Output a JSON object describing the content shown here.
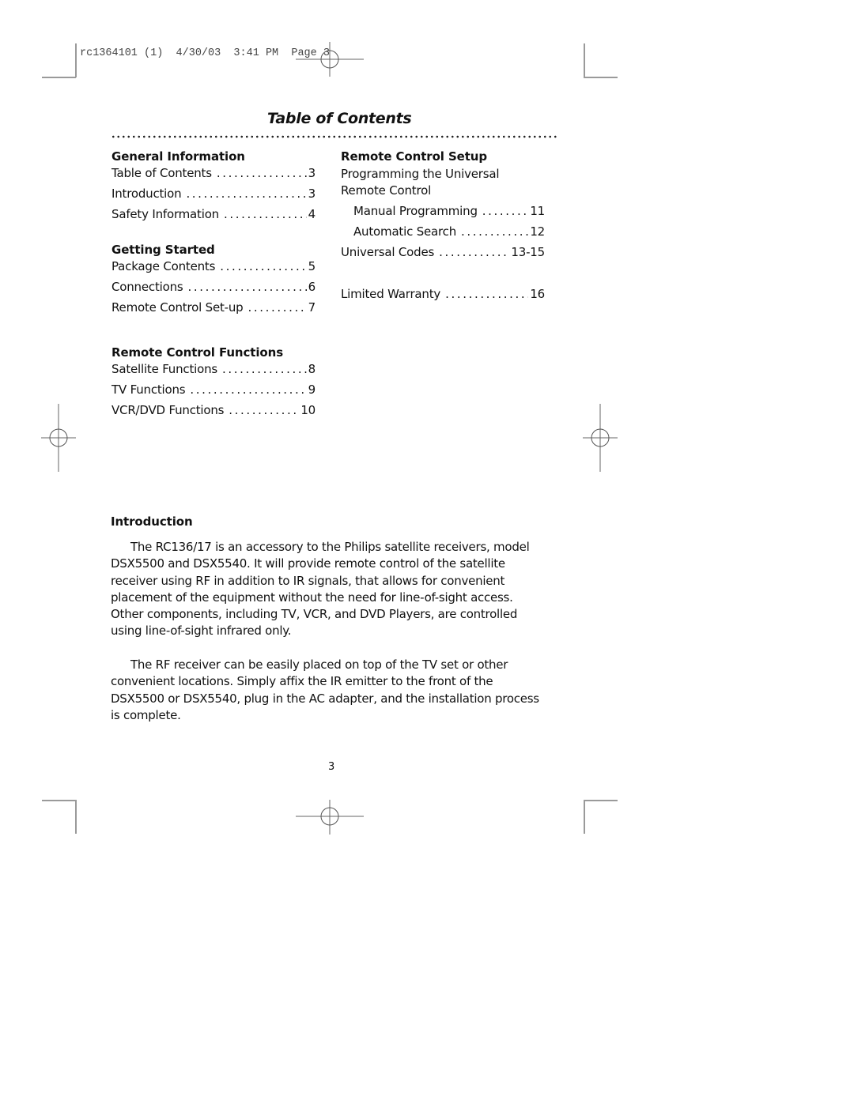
{
  "slug_line": "rc1364101 (1)  4/30/03  3:41 PM  Page 3",
  "title": "Table of Contents",
  "left_column": [
    {
      "heading": "General Information",
      "entries": [
        {
          "label": "Table of Contents",
          "page": "3"
        },
        {
          "label": "Introduction",
          "page": "3"
        },
        {
          "label": "Safety Information",
          "page": "4"
        }
      ]
    },
    {
      "heading": "Getting Started",
      "entries": [
        {
          "label": "Package Contents",
          "page": "5"
        },
        {
          "label": "Connections",
          "page": "6"
        },
        {
          "label": "Remote Control Set-up",
          "page": "7"
        }
      ]
    },
    {
      "heading": "Remote Control Functions",
      "entries": [
        {
          "label": "Satellite Functions",
          "page": "8"
        },
        {
          "label": "TV Functions",
          "page": "9"
        },
        {
          "label": "VCR/DVD Functions",
          "page": "10"
        }
      ]
    }
  ],
  "right_column": {
    "heading": "Remote Control Setup",
    "intro_text": "Programming the Universal Remote Control",
    "sub_entries": [
      {
        "label": "Manual Programming",
        "page": "11"
      },
      {
        "label": "Automatic Search",
        "page": "12"
      }
    ],
    "entries": [
      {
        "label": "Universal Codes",
        "page": "13-15"
      },
      {
        "label": "Limited Warranty",
        "page": "16"
      }
    ]
  },
  "introduction": {
    "heading": "Introduction",
    "paragraphs": [
      "The RC136/17 is an accessory to the Philips satellite receivers, model DSX5500 and DSX5540.  It will provide remote control of the satellite receiver using RF in addition to IR signals, that allows for convenient placement of the equipment without the need for line-of-sight access.  Other components, including TV, VCR, and DVD Players, are controlled using line-of-sight infrared only.",
      "The RF receiver can be easily placed on top of the TV set or other convenient locations.  Simply affix the IR emitter to the front of the DSX5500 or DSX5540, plug in the AC adapter, and the installation process is complete."
    ]
  },
  "page_number": "3",
  "dots": "................................"
}
